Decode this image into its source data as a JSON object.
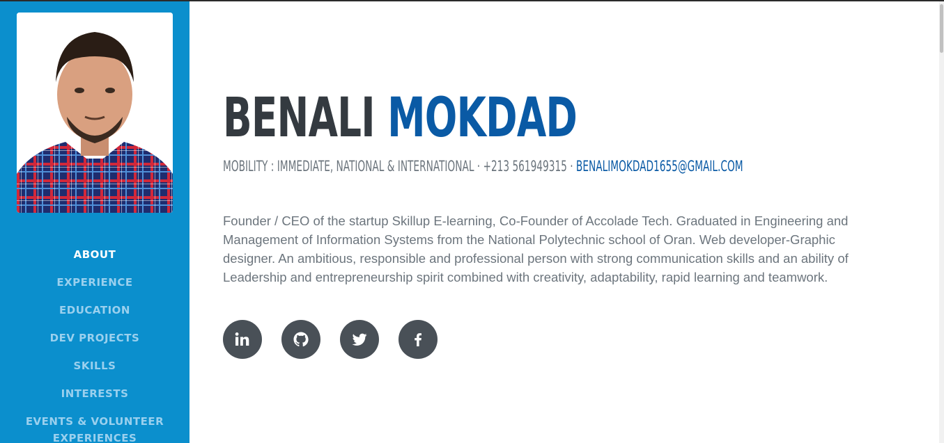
{
  "profile": {
    "first_name": "BENALI",
    "last_name": "MOKDAD",
    "subheading_prefix": "MOBILITY : IMMEDIATE, NATIONAL & INTERNATIONAL · +213 561949315 · ",
    "email": "BENALIMOKDAD1655@GMAIL.COM",
    "about": "Founder / CEO of the startup Skillup E-learning, Co-Founder of Accolade Tech. Graduated in Engineering and Management of Information Systems from the National Polytechnic school of Oran. Web developer-Graphic designer. An ambitious, responsible and professional person with strong communication skills and an ability of Leadership and entrepreneurship spirit combined with creativity, adaptability, rapid learning and teamwork."
  },
  "nav": {
    "items": [
      {
        "label": "ABOUT",
        "active": true
      },
      {
        "label": "EXPERIENCE",
        "active": false
      },
      {
        "label": "EDUCATION",
        "active": false
      },
      {
        "label": "DEV PROJECTS",
        "active": false
      },
      {
        "label": "SKILLS",
        "active": false
      },
      {
        "label": "INTERESTS",
        "active": false
      },
      {
        "label": "EVENTS & VOLUNTEER EXPERIENCES",
        "active": false
      }
    ]
  },
  "social": {
    "icons": [
      "linkedin-icon",
      "github-icon",
      "twitter-icon",
      "facebook-icon"
    ]
  },
  "colors": {
    "sidebar": "#0b8fcd",
    "name_primary": "#343a40",
    "accent": "#0a5aa5",
    "text_muted": "#6c757d",
    "social_bg": "#495057"
  }
}
